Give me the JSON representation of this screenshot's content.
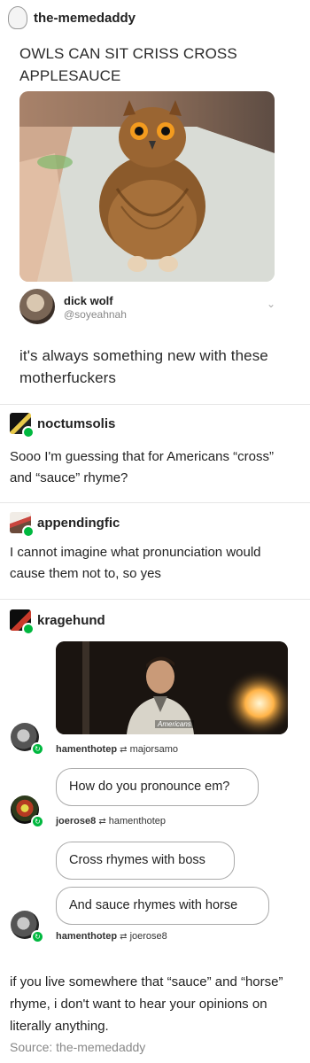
{
  "header": {
    "username": "the-memedaddy"
  },
  "tweet": {
    "headline": "OWLS CAN SIT CRISS CROSS APPLESAUCE",
    "author_name": "dick wolf",
    "author_handle": "@soyeahnah",
    "body": "it's always something new with these motherfuckers"
  },
  "reblogs": [
    {
      "username": "noctumsolis",
      "text": "Sooo I'm guessing that for Americans “cross” and “sauce” rhyme?"
    },
    {
      "username": "appendingfic",
      "text": "I cannot imagine what pronunciation would cause them not to, so yes"
    },
    {
      "username": "kragehund"
    }
  ],
  "gif": {
    "caption": "Americans"
  },
  "chat": {
    "meta1": {
      "from": "hamenthotep",
      "to": "majorsamo"
    },
    "bubble1": "How do you pronounce em?",
    "meta2": {
      "from": "joerose8",
      "to": "hamenthotep"
    },
    "bubble2": "Cross rhymes with boss",
    "bubble3": "And sauce rhymes with horse",
    "meta3": {
      "from": "hamenthotep",
      "to": "joerose8"
    }
  },
  "footer": {
    "text": "if you live somewhere that “sauce” and “horse” rhyme, i don't want to hear your opinions on literally anything.",
    "source": "Source: the-memedaddy"
  },
  "colors": {
    "reblog_green": "#00b83f",
    "divider": "#e6e6e6"
  }
}
